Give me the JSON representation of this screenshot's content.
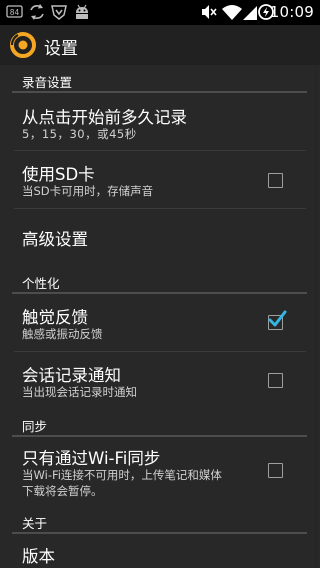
{
  "status_bar": {
    "time": "10:09",
    "notification_badge": "84",
    "icons": [
      "notification-count-icon",
      "sync-icon",
      "browser-icon",
      "android-icon",
      "mute-icon",
      "wifi-icon",
      "signal-icon",
      "battery-icon"
    ]
  },
  "action_bar": {
    "title": "设置"
  },
  "settings": {
    "recording_header": "录音设置",
    "start_time_title": "从点击开始前多久记录",
    "start_time_summary": "5，15，30，或45秒",
    "use_sd_title": "使用SD卡",
    "use_sd_summary": "当SD卡可用时，存储声音",
    "use_sd_checked": false,
    "advanced_title": "高级设置",
    "personalize_header": "个性化",
    "haptic_title": "触觉反馈",
    "haptic_summary": "触感或振动反馈",
    "haptic_checked": true,
    "notify_title": "会话记录通知",
    "notify_summary": "当出现会话记录时通知",
    "notify_checked": false,
    "sync_header": "同步",
    "wifi_sync_title": "只有通过Wi-Fi同步",
    "wifi_sync_summary_line1": "当Wi-Fi连接不可用时，上传笔记和媒体",
    "wifi_sync_summary_line2": "下载将会暂停。",
    "wifi_sync_checked": false,
    "about_header": "关于",
    "version_title": "版本"
  },
  "colors": {
    "accent": "#F5A623",
    "check": "#33B5E5",
    "background": "#282828",
    "action_bar": "#212121"
  }
}
